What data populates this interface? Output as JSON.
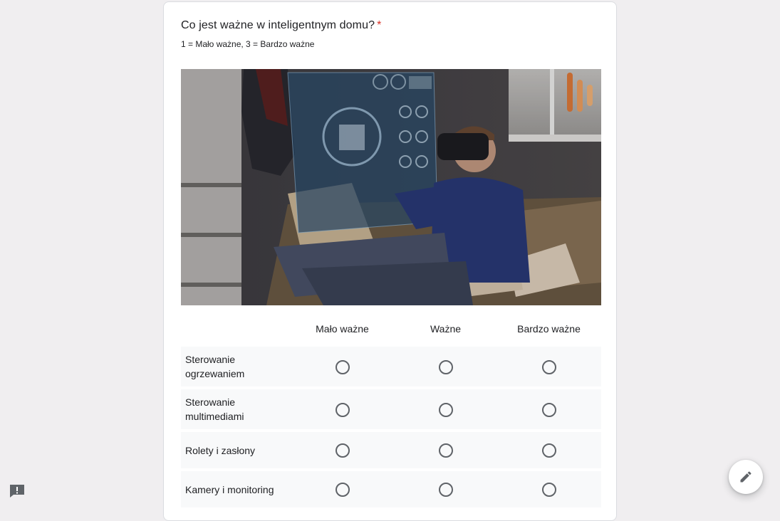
{
  "question": {
    "title": "Co jest ważne w inteligentnym domu?",
    "required_mark": "*",
    "description": "1 = Mało ważne, 3 = Bardzo ważne"
  },
  "image": {
    "icon": "smart-home-vr-photo"
  },
  "grid": {
    "columns": [
      {
        "label": "Mało ważne"
      },
      {
        "label": "Ważne"
      },
      {
        "label": "Bardzo ważne"
      }
    ],
    "rows": [
      {
        "label": "Sterowanie ogrzewaniem"
      },
      {
        "label": "Sterowanie multimediami"
      },
      {
        "label": "Rolety i zasłony"
      },
      {
        "label": "Kamery i monitoring"
      }
    ]
  },
  "colors": {
    "required": "#d93025",
    "row_background": "#f8f9fa",
    "page_background": "#f0eef0"
  },
  "floating": {
    "edit_icon": "pencil-icon",
    "feedback_icon": "feedback-icon"
  }
}
